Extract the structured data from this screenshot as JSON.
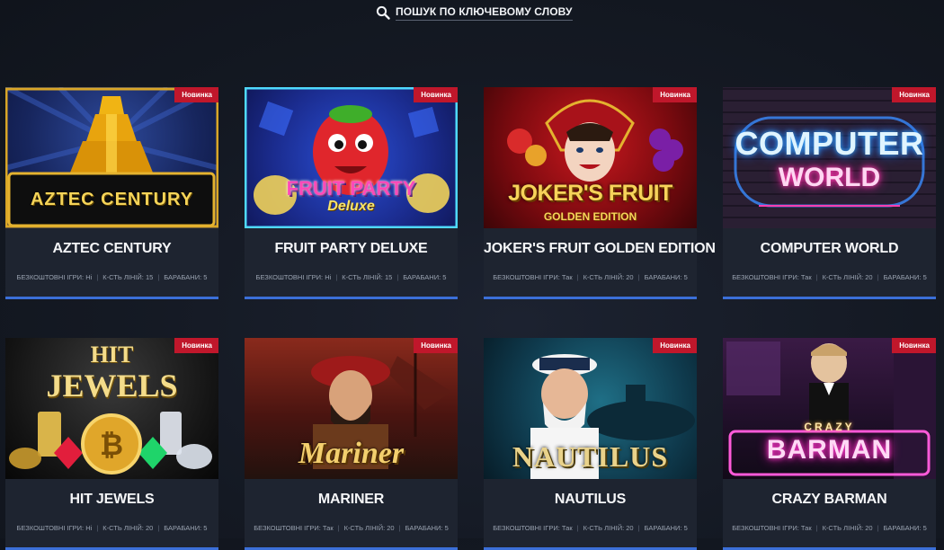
{
  "search": {
    "label": "ПОШУК ПО КЛЮЧЕВОМУ СЛОВУ",
    "icon": "search-icon"
  },
  "meta_labels": {
    "free_spins": "БЕЗКОШТОВНІ ІГРИ:",
    "lines": "К-СТЬ ЛІНІЙ:",
    "reels": "БАРАБАНИ:"
  },
  "badge_color": "#c0172b",
  "accent_color": "#3b6fd8",
  "games": [
    {
      "title": "AZTEC CENTURY",
      "badge": "Новинка",
      "free": "Ні",
      "lines": "15",
      "reels": "5",
      "logo": "AZTEC CENTURY"
    },
    {
      "title": "FRUIT PARTY DELUXE",
      "badge": "Новинка",
      "free": "Ні",
      "lines": "15",
      "reels": "5",
      "logo": "FRUIT PARTY",
      "logo2": "Deluxe"
    },
    {
      "title": "JOKER'S FRUIT GOLDEN EDITION",
      "badge": "Новинка",
      "free": "Так",
      "lines": "20",
      "reels": "5",
      "logo": "JOKER'S FRUIT",
      "logo2": "GOLDEN EDITION"
    },
    {
      "title": "COMPUTER WORLD",
      "badge": "Новинка",
      "free": "Так",
      "lines": "20",
      "reels": "5",
      "logo": "COMPUTER",
      "logo2": "WORLD"
    },
    {
      "title": "HIT JEWELS",
      "badge": "Новинка",
      "free": "Ні",
      "lines": "20",
      "reels": "5",
      "logo": "HIT",
      "logo2": "JEWELS"
    },
    {
      "title": "MARINER",
      "badge": "Новинка",
      "free": "Так",
      "lines": "20",
      "reels": "5",
      "logo": "Mariner"
    },
    {
      "title": "NAUTILUS",
      "badge": "Новинка",
      "free": "Так",
      "lines": "20",
      "reels": "5",
      "logo": "NAUTILUS"
    },
    {
      "title": "CRAZY BARMAN",
      "badge": "Новинка",
      "free": "Так",
      "lines": "20",
      "reels": "5",
      "logo": "BARMAN",
      "logo2": "CRAZY"
    }
  ]
}
